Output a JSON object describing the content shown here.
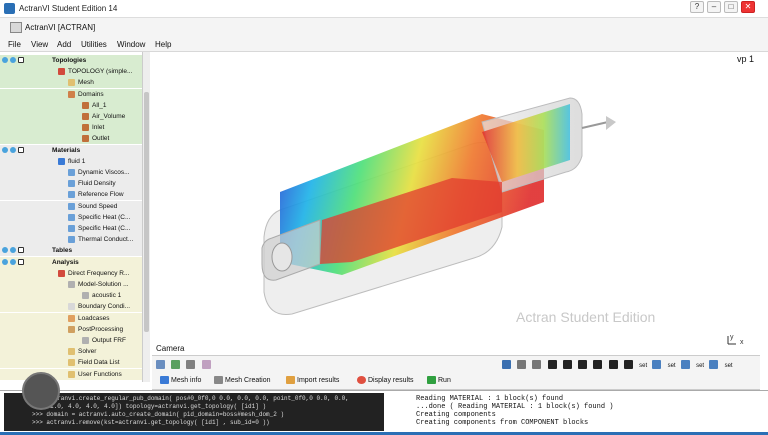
{
  "window": {
    "title": "ActranVI Student Edition 14",
    "subtitle": "ActranVI [ACTRAN]",
    "buttons": {
      "help": "?",
      "minimize": "–",
      "maximize": "□",
      "close": "✕"
    }
  },
  "menu": [
    "File",
    "View",
    "Add",
    "Utilities",
    "Window",
    "Help"
  ],
  "tree": [
    {
      "label": "Topologies",
      "header": true,
      "bg": "green",
      "indent": 52
    },
    {
      "label": "TOPOLOGY (simple...",
      "bg": "green",
      "indent": 68,
      "icon": "#d24a3c"
    },
    {
      "label": "Mesh",
      "bg": "green",
      "indent": 78,
      "icon": "#e0c070"
    },
    {
      "label": "Domains",
      "bg": "green",
      "indent": 78,
      "icon": "#d0804a"
    },
    {
      "label": "All_1",
      "bg": "green",
      "indent": 92,
      "icon": "#c0703a"
    },
    {
      "label": "Air_Volume",
      "bg": "green",
      "indent": 92,
      "icon": "#c0703a"
    },
    {
      "label": "Inlet",
      "bg": "green",
      "indent": 92,
      "icon": "#c0703a"
    },
    {
      "label": "Outlet",
      "bg": "green",
      "indent": 92,
      "icon": "#c0703a"
    },
    {
      "label": "Materials",
      "header": true,
      "bg": "gray",
      "indent": 52
    },
    {
      "label": "fluid 1",
      "bg": "gray",
      "indent": 68,
      "icon": "#3a7ad6"
    },
    {
      "label": "Dynamic Viscos...",
      "bg": "gray",
      "indent": 78,
      "icon": "#6aa0d8"
    },
    {
      "label": "Fluid Density",
      "bg": "gray",
      "indent": 78,
      "icon": "#6aa0d8"
    },
    {
      "label": "Reference Flow",
      "bg": "gray",
      "indent": 78,
      "icon": "#6aa0d8"
    },
    {
      "label": "Sound Speed",
      "bg": "gray",
      "indent": 78,
      "icon": "#6aa0d8"
    },
    {
      "label": "Specific Heat (C...",
      "bg": "gray",
      "indent": 78,
      "icon": "#6aa0d8"
    },
    {
      "label": "Specific Heat (C...",
      "bg": "gray",
      "indent": 78,
      "icon": "#6aa0d8"
    },
    {
      "label": "Thermal Conduct...",
      "bg": "gray",
      "indent": 78,
      "icon": "#6aa0d8"
    },
    {
      "label": "Tables",
      "header": true,
      "bg": "gray",
      "indent": 52
    },
    {
      "label": "Analysis",
      "header": true,
      "bg": "yellow",
      "indent": 52
    },
    {
      "label": "Direct Frequency R...",
      "bg": "yellow",
      "indent": 68,
      "icon": "#d24a3c"
    },
    {
      "label": "Model-Solution ...",
      "bg": "yellow",
      "indent": 78,
      "icon": "#b0b0b0"
    },
    {
      "label": "acoustic 1",
      "bg": "yellow",
      "indent": 92,
      "icon": "#b0b0b0"
    },
    {
      "label": "Boundary Condi...",
      "bg": "yellow",
      "indent": 78,
      "icon": "#d8d8d8"
    },
    {
      "label": "Loadcases",
      "bg": "yellow",
      "indent": 78,
      "icon": "#e0a060"
    },
    {
      "label": "PostProcessing",
      "bg": "yellow",
      "indent": 78,
      "icon": "#d0a060"
    },
    {
      "label": "Output FRF",
      "bg": "yellow",
      "indent": 92,
      "icon": "#b0b0b0"
    },
    {
      "label": "Solver",
      "bg": "yellow",
      "indent": 78,
      "icon": "#e0c070"
    },
    {
      "label": "Field Data List",
      "bg": "yellow",
      "indent": 78,
      "icon": "#e0c070"
    },
    {
      "label": "User Functions",
      "bg": "yellow",
      "indent": 78,
      "icon": "#e0c070"
    }
  ],
  "viewport": {
    "label": "vp 1",
    "watermark": "Actran Student Edition",
    "camera_label": "Camera"
  },
  "bottom_tabs": [
    "Mesh info",
    "Mesh Creation",
    "Import results",
    "Display results",
    "Run"
  ],
  "view_tools_right": [
    "set",
    "set",
    "set",
    "set"
  ],
  "console_left": [
    ">>> actranvi.create_regular_pub_domain( pos#0_0f0,0 0.0, 0.0, 0.0, point_0f0,0 0.0, 0.0,",
    "  1.0, 1.0, 4.0, 4.0, 4.0]) topology=actranvi.get_topology( [id1] )",
    ">>> domain = actranvi.auto_create_domain( pid_domain=boss#mesh_dom_2 )",
    ">>> actranvi.remove(kst=actranvi.get_topology( [id1] , sub_id=0 ))"
  ],
  "console_right": [
    "Reading MATERIAL : 1 block(s) found",
    "...done ( Reading MATERIAL : 1 block(s) found )",
    "Creating components",
    "  Creating components from COMPONENT blocks"
  ],
  "colors": {
    "accent": "#2a6fb5",
    "tree_green": "#d8ecd0",
    "tree_yellow": "#f3f2d9",
    "close_red": "#e33"
  }
}
